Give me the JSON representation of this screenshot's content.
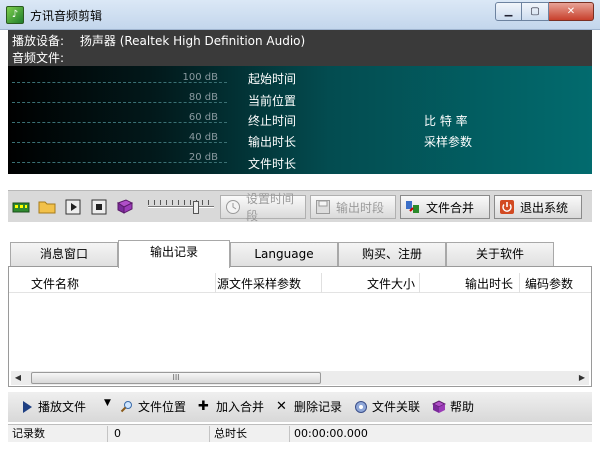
{
  "window": {
    "title": "方讯音频剪辑"
  },
  "info": {
    "device_label": "播放设备:",
    "device_value": "扬声器 (Realtek High Definition Audio)",
    "file_label": "音频文件:"
  },
  "meter": {
    "db_labels": [
      "100 dB",
      "80 dB",
      "60 dB",
      "40 dB",
      "20 dB"
    ],
    "start_time": "起始时间",
    "current_pos": "当前位置",
    "end_time": "终止时间",
    "output_length": "输出时长",
    "file_length": "文件时长",
    "bitrate": "比 特 率",
    "sample_params": "采样参数"
  },
  "volume_level": 0.75,
  "toolbar": {
    "set_segment": "设置时间段",
    "output_segment": "输出时段",
    "merge_files": "文件合并",
    "exit": "退出系统"
  },
  "tabs": [
    "消息窗口",
    "输出记录",
    "Language",
    "购买、注册",
    "关于软件"
  ],
  "active_tab": 1,
  "list": {
    "columns": [
      "文件名称",
      "源文件采样参数",
      "文件大小",
      "输出时长",
      "编码参数"
    ],
    "scroll_grip": "III"
  },
  "actions": {
    "play_file": "播放文件",
    "file_location": "文件位置",
    "add_merge": "加入合并",
    "delete_record": "删除记录",
    "file_assoc": "文件关联",
    "help": "帮助"
  },
  "status": {
    "record_count_label": "记录数",
    "record_count": "0",
    "total_length_label": "总时长",
    "total_length": "00:00:00.000"
  },
  "icons": {
    "app": "app-logo-icon",
    "minimize": "minimize-icon",
    "maximize": "maximize-icon",
    "close": "close-icon"
  }
}
